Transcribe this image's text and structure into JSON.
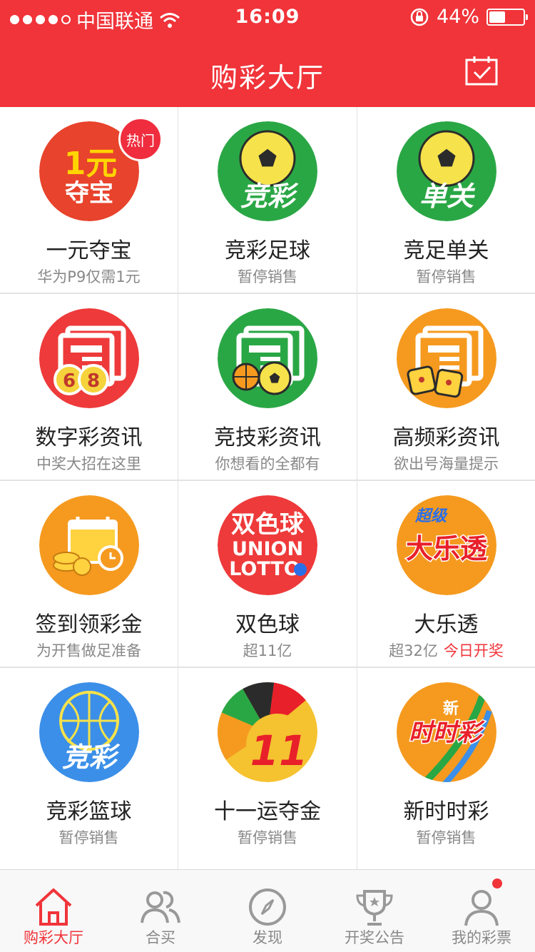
{
  "status_bar": {
    "carrier": "中国联通",
    "time": "16:09",
    "battery": "44%",
    "battery_fraction": 0.44
  },
  "header": {
    "title": "购彩大厅"
  },
  "hot_badge": "热门",
  "grid": [
    {
      "id": "yiyuan",
      "name": "一元夺宝",
      "sub": "华为P9仅需1元",
      "logo": [
        "1元",
        "夺宝"
      ],
      "color": "#e8432c"
    },
    {
      "id": "jczq",
      "name": "竞彩足球",
      "sub": "暂停销售",
      "logo": [
        "竞彩"
      ],
      "color": "#2aa745"
    },
    {
      "id": "jzdg",
      "name": "竞足单关",
      "sub": "暂停销售",
      "logo": [
        "单关"
      ],
      "color": "#2aa745"
    },
    {
      "id": "szcxx",
      "name": "数字彩资讯",
      "sub": "中奖大招在这里",
      "logo": [
        "6",
        "8"
      ],
      "color": "#ee3a3a"
    },
    {
      "id": "jjcxx",
      "name": "竞技彩资讯",
      "sub": "你想看的全都有",
      "logo": [],
      "color": "#2aa745"
    },
    {
      "id": "gpcxx",
      "name": "高频彩资讯",
      "sub": "欲出号海量提示",
      "logo": [],
      "color": "#f59a1f"
    },
    {
      "id": "qiandao",
      "name": "签到领彩金",
      "sub": "为开售做足准备",
      "logo": [],
      "color": "#f59a1f"
    },
    {
      "id": "ssq",
      "name": "双色球",
      "sub": "超11亿",
      "logo": [
        "双色球",
        "UNION",
        "LOTTO"
      ],
      "color": "#ee3a3a"
    },
    {
      "id": "dlt",
      "name": "大乐透",
      "sub": "超32亿",
      "sub_highlight": "今日开奖",
      "logo": [
        "超级",
        "大乐透"
      ],
      "color": "#f59a1f"
    },
    {
      "id": "jclq",
      "name": "竞彩篮球",
      "sub": "暂停销售",
      "logo": [
        "竞彩"
      ],
      "color": "#3b8fe8"
    },
    {
      "id": "syydj",
      "name": "十一运夺金",
      "sub": "暂停销售",
      "logo": [
        "11"
      ],
      "color": "#f5c230"
    },
    {
      "id": "xssc",
      "name": "新时时彩",
      "sub": "暂停销售",
      "logo": [
        "新",
        "时时彩"
      ],
      "color": "#f59a1f"
    }
  ],
  "tabs": [
    {
      "label": "购彩大厅",
      "icon": "home-icon",
      "active": true
    },
    {
      "label": "合买",
      "icon": "group-icon",
      "active": false
    },
    {
      "label": "发现",
      "icon": "compass-icon",
      "active": false
    },
    {
      "label": "开奖公告",
      "icon": "trophy-icon",
      "active": false
    },
    {
      "label": "我的彩票",
      "icon": "user-icon",
      "active": false,
      "badge": true
    }
  ],
  "colors": {
    "brand_red": "#f0343a",
    "green": "#2aa745",
    "orange": "#f59a1f",
    "blue": "#3b8fe8"
  }
}
